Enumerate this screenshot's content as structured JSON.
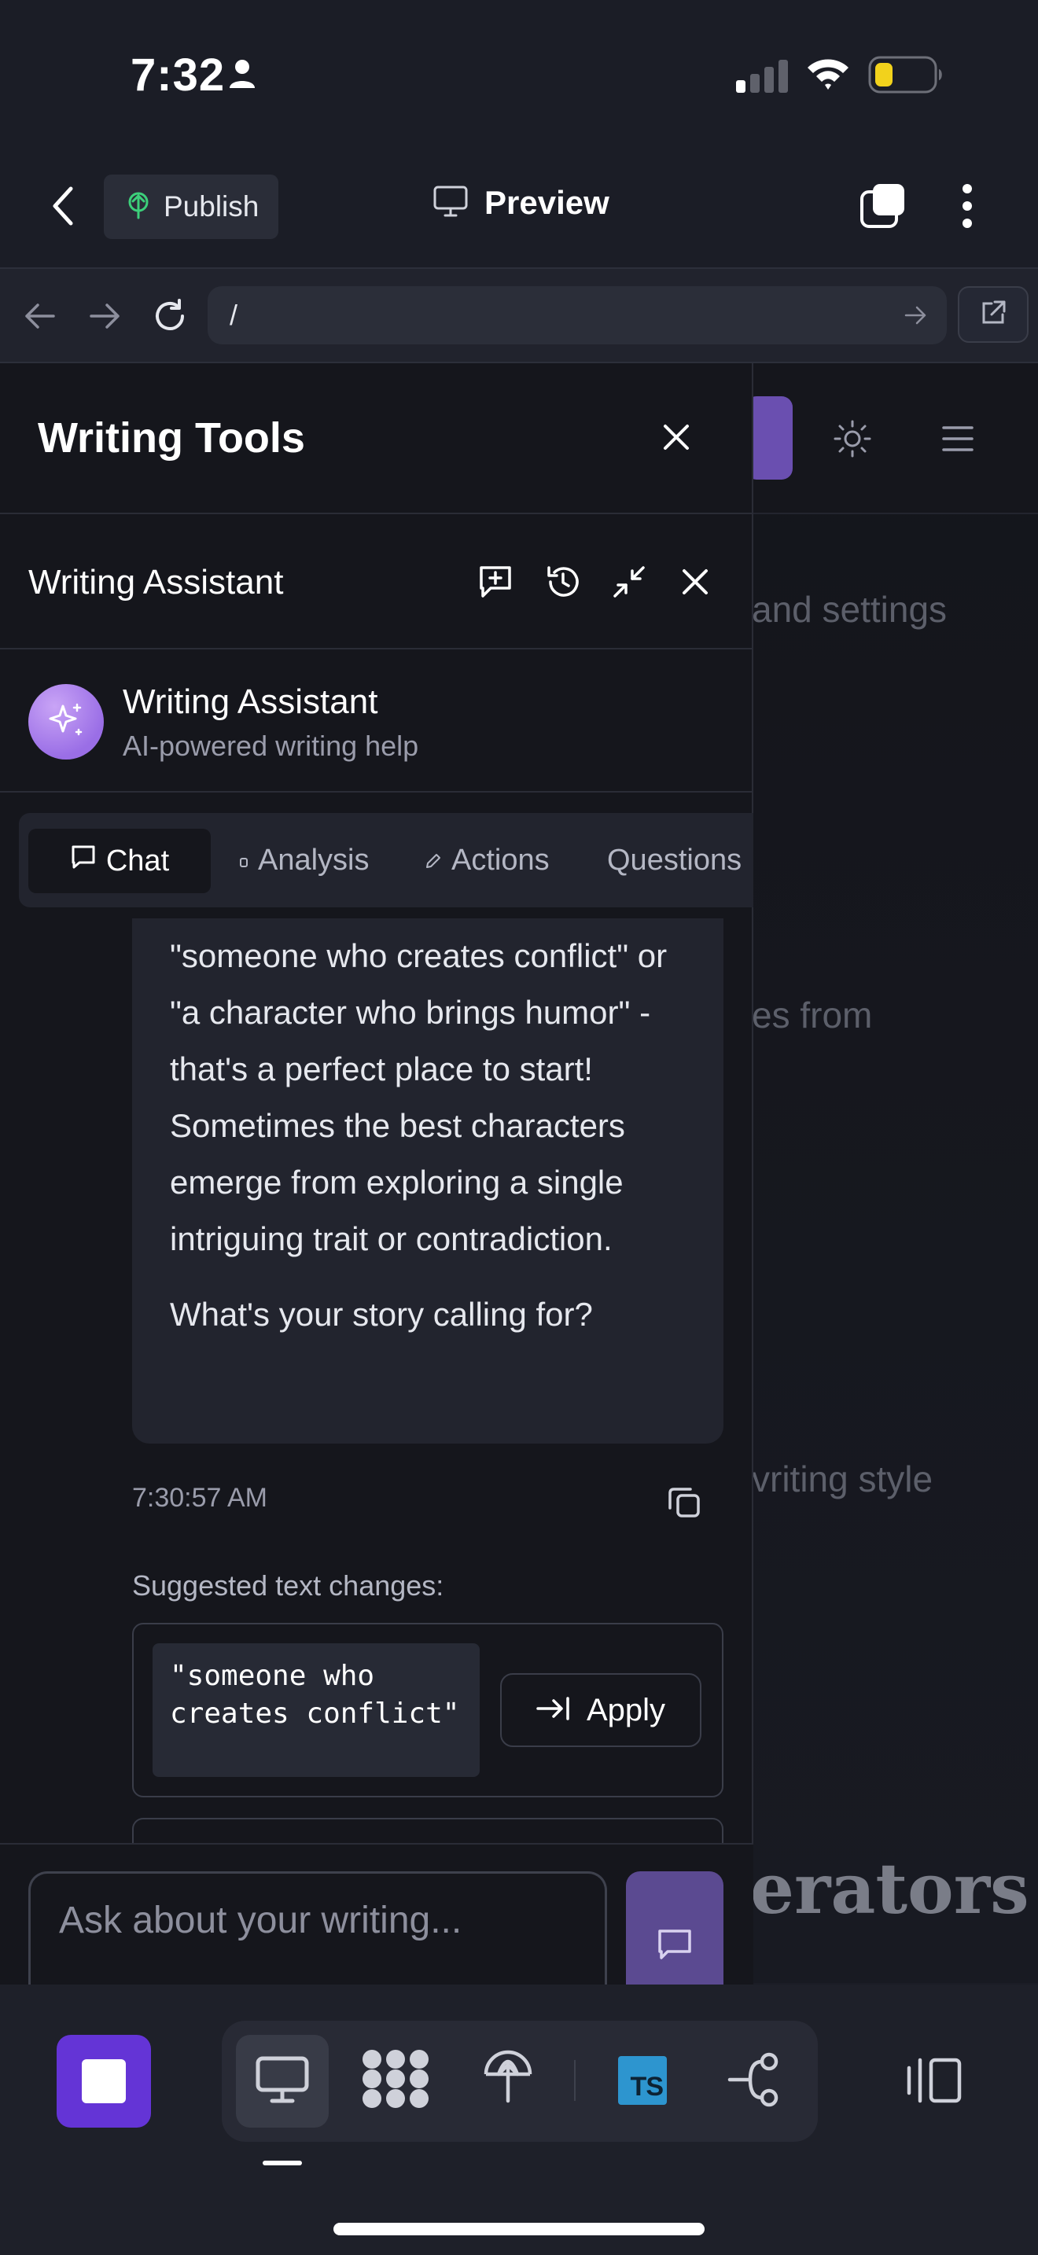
{
  "status_bar": {
    "time": "7:32"
  },
  "app_header": {
    "publish_label": "Publish",
    "preview_label": "Preview"
  },
  "browser": {
    "url": "/"
  },
  "background_page": {
    "text_1": "and settings",
    "text_2": "es from",
    "text_3": "vriting style",
    "heading": "erators"
  },
  "writing_tools": {
    "title": "Writing Tools",
    "assistant_bar_title": "Writing Assistant",
    "profile": {
      "name": "Writing Assistant",
      "subtitle": "AI-powered writing help"
    },
    "tabs": [
      "Chat",
      "Analysis",
      "Actions",
      "Questions"
    ],
    "message": {
      "paragraph_1": "\"someone who creates conflict\" or \"a character who brings humor\" - that's a perfect place to start! Sometimes the best characters emerge from exploring a single intriguing trait or contradiction.",
      "paragraph_2": "What's your story calling for?",
      "timestamp": "7:30:57 AM"
    },
    "suggestions": {
      "label": "Suggested text changes:",
      "items": [
        {
          "text": "\"someone who creates conflict\"",
          "apply_label": "Apply"
        }
      ]
    },
    "input": {
      "placeholder": "Ask about your writing..."
    }
  },
  "dock": {
    "ts_label": "TS"
  },
  "colors": {
    "accent_purple": "#6434d6",
    "send_button": "#5b4a91",
    "avatar": "#9a6ee6",
    "publish_icon": "#3ccf7a",
    "battery_low": "#f2d21c"
  }
}
